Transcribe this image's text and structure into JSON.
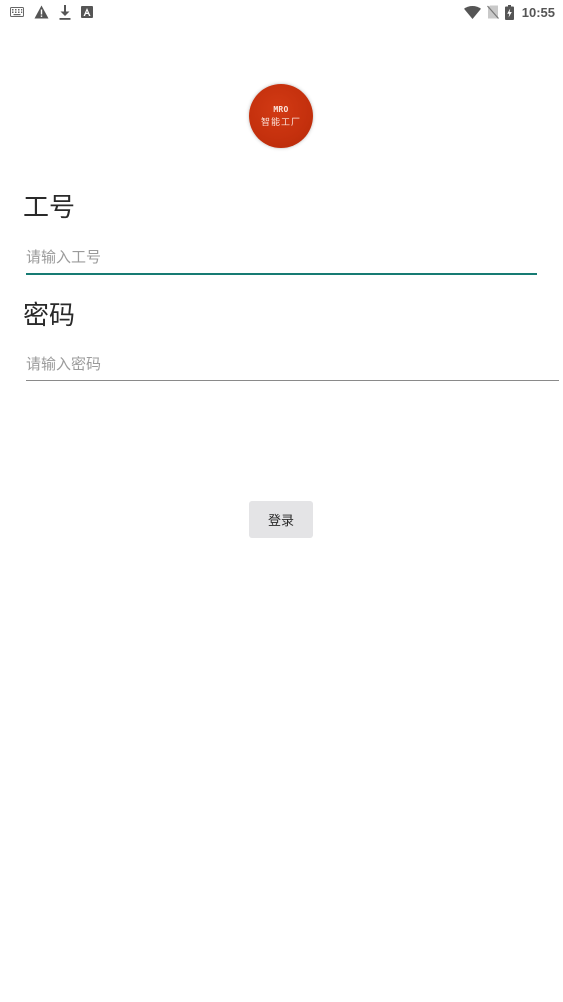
{
  "status_bar": {
    "time": "10:55",
    "left_icons": [
      "keyboard-icon",
      "warning-icon",
      "download-icon",
      "accessibility-icon"
    ],
    "right_icons": [
      "wifi-icon",
      "no-sim-icon",
      "battery-charging-icon"
    ]
  },
  "logo": {
    "line1": "MRO",
    "line2": "智能工厂",
    "color": "#c4300d"
  },
  "form": {
    "employee_id": {
      "label": "工号",
      "placeholder": "请输入工号",
      "value": ""
    },
    "password": {
      "label": "密码",
      "placeholder": "请输入密码",
      "value": ""
    },
    "login_label": "登录"
  },
  "colors": {
    "focused_underline": "#167b73",
    "button_bg": "#e4e4e6"
  }
}
